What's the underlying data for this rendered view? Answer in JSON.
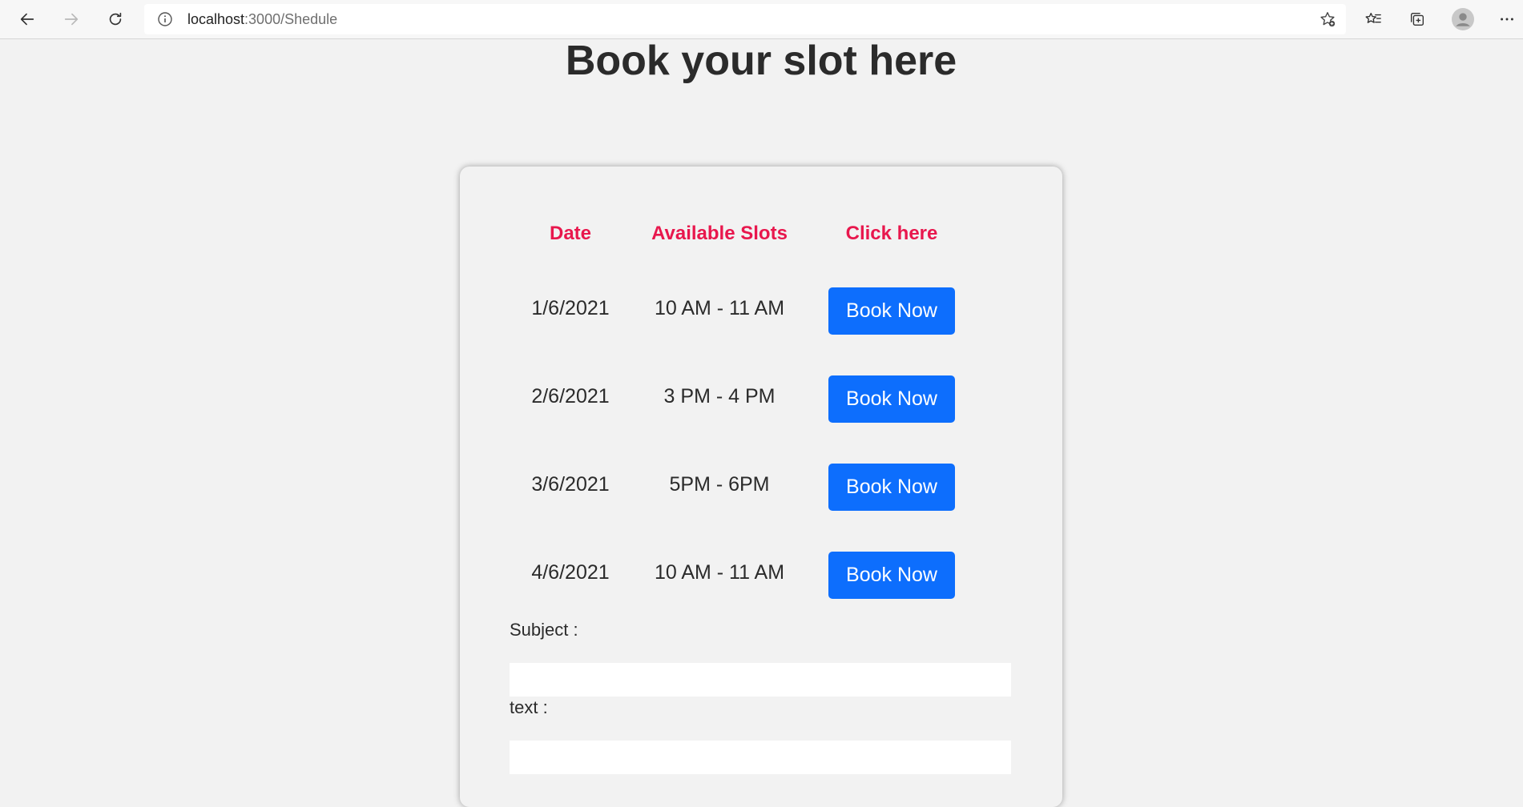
{
  "browser": {
    "url_host": "localhost",
    "url_path": ":3000/Shedule"
  },
  "page": {
    "title": "Book your slot here"
  },
  "table": {
    "headers": [
      "Date",
      "Available Slots",
      "Click here"
    ],
    "rows": [
      {
        "date": "1/6/2021",
        "slot": "10 AM - 11 AM",
        "button": "Book Now"
      },
      {
        "date": "2/6/2021",
        "slot": "3 PM - 4 PM",
        "button": "Book Now"
      },
      {
        "date": "3/6/2021",
        "slot": "5PM - 6PM",
        "button": "Book Now"
      },
      {
        "date": "4/6/2021",
        "slot": "10 AM - 11 AM",
        "button": "Book Now"
      }
    ]
  },
  "form": {
    "subject_label": "Subject :",
    "subject_value": "",
    "text_label": "text :",
    "text_value": ""
  },
  "colors": {
    "header_accent": "#e8174d",
    "button_primary": "#0d6efd"
  }
}
